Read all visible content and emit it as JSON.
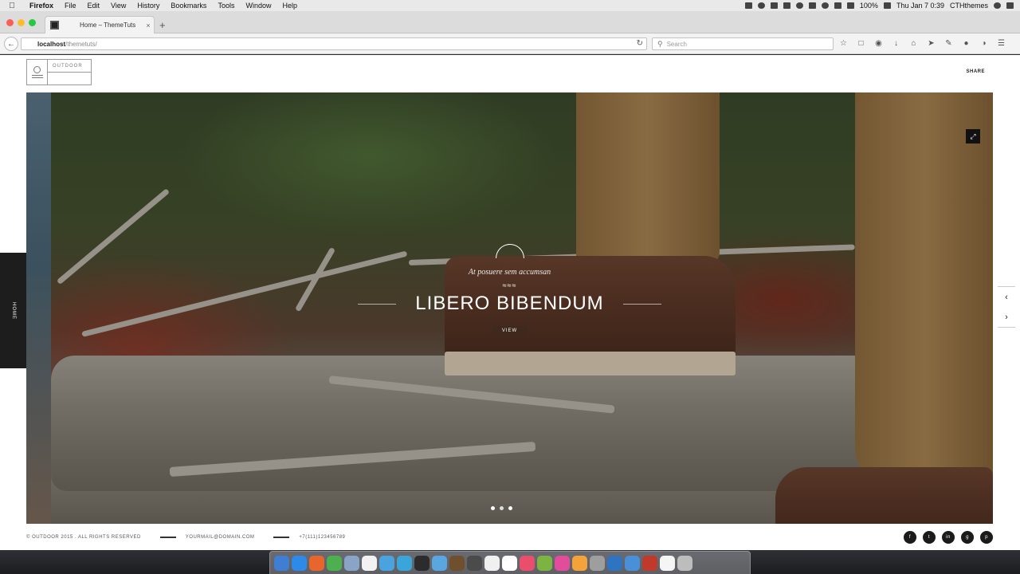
{
  "menubar": {
    "app_name": "Firefox",
    "menus": [
      "File",
      "Edit",
      "View",
      "History",
      "Bookmarks",
      "Tools",
      "Window",
      "Help"
    ],
    "battery": "100%",
    "clock": "Thu Jan 7  0:39",
    "user": "CTHthemes"
  },
  "browser": {
    "tab_title": "Home – ThemeTuts",
    "tab_close": "×",
    "new_tab": "+",
    "url_host": "localhost",
    "url_path": "/themetuts/",
    "reload": "↻",
    "search_placeholder": "Search"
  },
  "site": {
    "logo_word": "OUTDOOR",
    "share_label": "SHARE",
    "side_nav_label": "HOME",
    "slide": {
      "subtitle": "At posuere sem accumsan",
      "wave": "≈≈≈",
      "title": "LIBERO BIBENDUM",
      "button": "VIEW"
    },
    "dots": 3,
    "active_dot": 1,
    "arrow_prev": "‹",
    "arrow_next": "›",
    "expand": "⤢"
  },
  "footer": {
    "copyright": "© OUTDOOR 2015 . ALL RIGHTS RESERVED",
    "email": "YOURMAIL@DOMAIN.COM",
    "phone": "+7(111)123456789",
    "socials": [
      "f",
      "t",
      "in",
      "g",
      "p"
    ]
  },
  "colors": {
    "page_bg": "#ffffff",
    "dark": "#1d1d1d",
    "close": "#fc5f57",
    "minimize": "#fdbc2e",
    "maximize": "#28c840"
  },
  "dock_apps": [
    "#3f7fd3",
    "#2d8ae8",
    "#e8652b",
    "#4caf50",
    "#8aa4c8",
    "#f2f2f2",
    "#4aa3df",
    "#3aa5d8",
    "#2c2c2c",
    "#5aa7e0",
    "#6e4f2e",
    "#4b4b4b",
    "#f0f0f0",
    "#ffffff",
    "#e94f6c",
    "#7cb342",
    "#e14d9b",
    "#f3a33a",
    "#9e9e9e",
    "#2f74c0",
    "#4a90d9",
    "#c0392b",
    "#f5f5f5",
    "#bdbdbd"
  ]
}
